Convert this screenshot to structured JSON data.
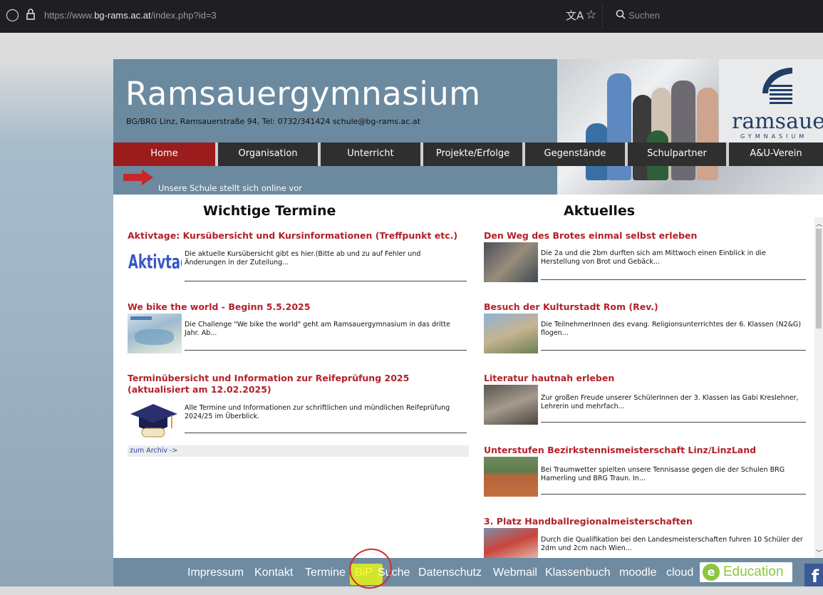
{
  "browser": {
    "url_prefix": "https://www.",
    "url_domain": "bg-rams.ac.at",
    "url_path": "/index.php?id=3",
    "search_placeholder": "Suchen"
  },
  "header": {
    "title": "Ramsauergymnasium",
    "subtitle": "BG/BRG Linz, Ramsauerstraße 94, Tel: 0732/341424 schule@bg-rams.ac.at",
    "logo_text": "ramsauer",
    "logo_sub": "GYMNASIUM",
    "tagline": "Unsere Schule stellt sich online vor"
  },
  "nav": [
    {
      "label": "Home"
    },
    {
      "label": "Organisation"
    },
    {
      "label": "Unterricht"
    },
    {
      "label": "Projekte/Erfolge"
    },
    {
      "label": "Gegenstände"
    },
    {
      "label": "Schulpartner"
    },
    {
      "label": "A&U-Verein"
    }
  ],
  "termine": {
    "heading": "Wichtige Termine",
    "items": [
      {
        "title": "Aktivtage: Kursübersicht und Kursinformationen (Treffpunkt etc.)",
        "text": "Die aktuelle Kursübersicht gibt es hier.(Bitte ab und zu auf Fehler und Änderungen in der Zuteilung...",
        "thumb_label": "Aktivtage"
      },
      {
        "title": "We bike the world - Beginn 5.5.2025",
        "text": "Die Challenge \"We bike the world\" geht am Ramsauergymnasium in das dritte  Jahr. Ab..."
      },
      {
        "title": "Terminübersicht und Information zur Reifeprüfung 2025 (aktualisiert am 12.02.2025)",
        "text": "Alle Termine und Informationen zur schriftlichen und mündlichen Reifeprüfung 2024/25 im Überblick."
      }
    ],
    "archive": "zum Archiv ->"
  },
  "aktuelles": {
    "heading": "Aktuelles",
    "items": [
      {
        "title": "Den Weg des Brotes einmal selbst erleben",
        "text": "Die 2a und die 2bm durften sich am Mittwoch einen Einblick in die Herstellung von Brot und Gebäck..."
      },
      {
        "title": "Besuch der Kulturstadt Rom (Rev.)",
        "text": "Die TeilnehmerInnen des evang. Religionsunterrichtes der 6. Klassen (N2&G) flogen..."
      },
      {
        "title": "Literatur hautnah erleben",
        "text": "Zur großen Freude unserer SchülerInnen der 3. Klassen las Gabi Kreslehner, Lehrerin und mehrfach..."
      },
      {
        "title": "Unterstufen Bezirkstennismeisterschaft Linz/LinzLand",
        "text": "Bei Traumwetter spielten unsere Tennisasse gegen die der Schulen BRG Hamerling und BRG Traun. In..."
      },
      {
        "title": "3. Platz Handballregionalmeisterschaften",
        "text": "Durch die Qualifikation bei den Landesmeisterschaften fuhren 10 Schüler der 2dm und 2cm nach Wien..."
      }
    ]
  },
  "footer": {
    "links": [
      {
        "label": "Impressum"
      },
      {
        "label": "Kontakt"
      },
      {
        "label": "Termine"
      },
      {
        "label": "BiP"
      },
      {
        "label": "Suche"
      },
      {
        "label": "Datenschutz"
      },
      {
        "label": "Webmail"
      },
      {
        "label": "Klassenbuch"
      },
      {
        "label": "moodle"
      },
      {
        "label": "cloud"
      }
    ],
    "edu_label": "Education",
    "edu_mark": "e",
    "fb_mark": "f"
  },
  "colors": {
    "nav_active": "#9b1c1c",
    "nav": "#2f2f2f",
    "headline": "#b3212a",
    "header_bg": "#6b8aa0",
    "highlight": "#e6f21a"
  }
}
